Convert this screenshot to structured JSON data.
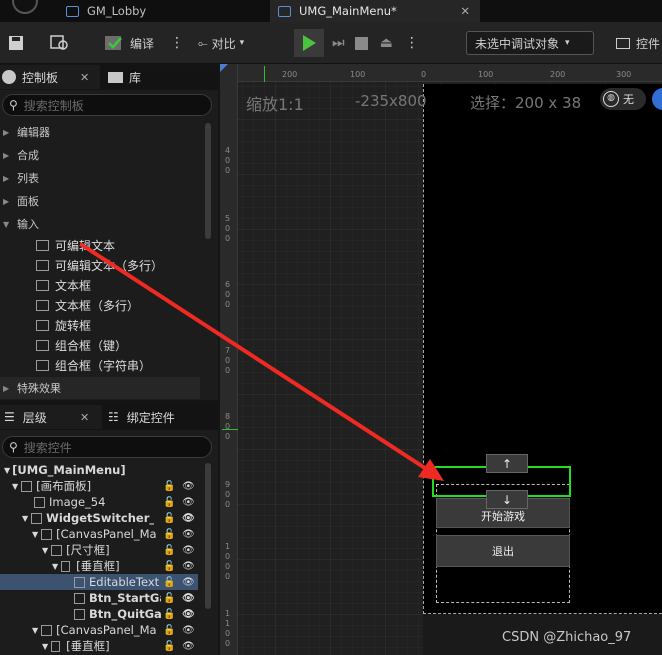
{
  "tabs": [
    {
      "label": "GM_Lobby"
    },
    {
      "label": "UMG_MainMenu*"
    }
  ],
  "toolbar": {
    "compile": "编译",
    "diff": "对比",
    "debug_target": "未选中调试对象",
    "console": "控件"
  },
  "palette": {
    "tab": "控制板",
    "lib_tab": "库",
    "search_placeholder": "搜索控制板",
    "categories": [
      "编辑器",
      "合成",
      "列表",
      "面板",
      "输入"
    ],
    "items": [
      "可编辑文本",
      "可编辑文本（多行）",
      "文本框",
      "文本框（多行）",
      "旋转框",
      "组合框（键）",
      "组合框（字符串）"
    ],
    "special": "特殊效果"
  },
  "hierarchy": {
    "tab": "层级",
    "bind_tab": "绑定控件",
    "search_placeholder": "搜索控件",
    "rows": [
      "[UMG_MainMenu]",
      "[画布面板]",
      "Image_54",
      "WidgetSwitcher_M",
      "[CanvasPanel_Ma",
      "[尺寸框]",
      "[垂直框]",
      "EditableText",
      "Btn_StartGa",
      "Btn_QuitGa",
      "[CanvasPanel_Ma",
      "[垂直框]"
    ]
  },
  "viewport": {
    "zoom": "缩放1:1",
    "dims": "-235x800",
    "selection": "选择：200 x 38",
    "none_label": "无",
    "ruler_top": [
      "200",
      "100",
      "0",
      "100",
      "200",
      "300"
    ],
    "ruler_left": [
      "400",
      "500",
      "600",
      "700",
      "800",
      "900",
      "1000",
      "1100"
    ],
    "btn_up": "↑",
    "btn_down": "↓",
    "btn_start": "开始游戏",
    "btn_quit": "退出"
  },
  "watermark": "CSDN @Zhichao_97",
  "colors": {
    "selection_green": "#22dd22",
    "arrow_red": "#ee2a22",
    "selected_row": "#3b5270"
  }
}
